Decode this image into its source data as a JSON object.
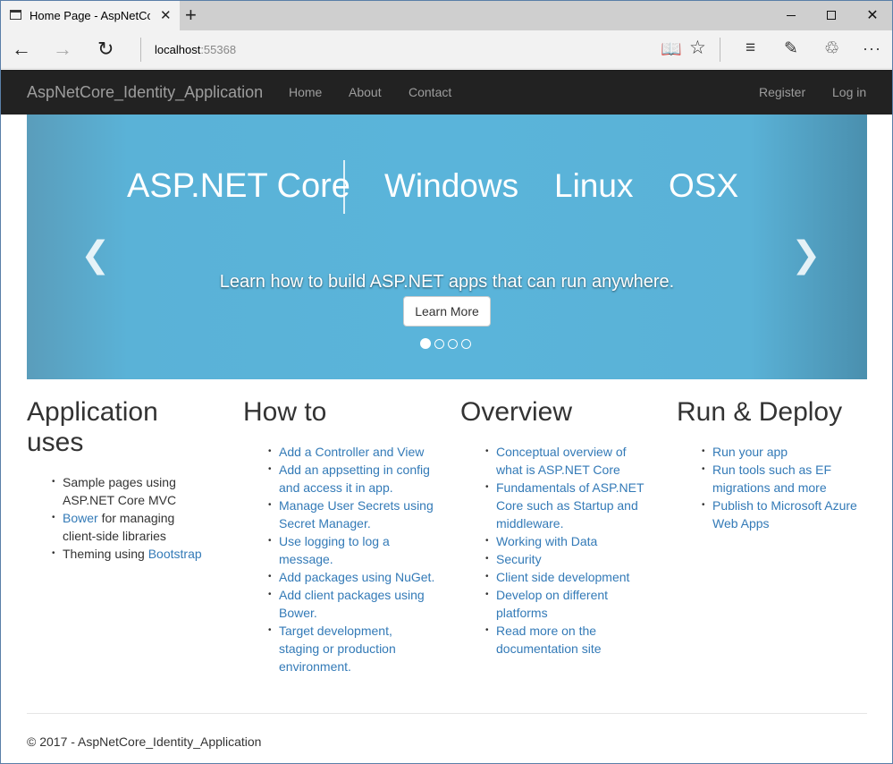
{
  "browser": {
    "tab_title": "Home Page - AspNetCo",
    "tab_close": "✕",
    "new_tab": "+",
    "url_host": "localhost",
    "url_port": ":55368"
  },
  "site": {
    "brand": "AspNetCore_Identity_Application",
    "nav": {
      "home": "Home",
      "about": "About",
      "contact": "Contact",
      "register": "Register",
      "login": "Log in"
    }
  },
  "carousel": {
    "words": {
      "aspnet": "ASP.NET Core",
      "windows": "Windows",
      "linux": "Linux",
      "osx": "OSX"
    },
    "caption": "Learn how to build ASP.NET apps that can run anywhere.",
    "button": "Learn More",
    "slide_count": 4,
    "active_slide": 1
  },
  "columns": [
    {
      "heading": "Application uses",
      "items": [
        {
          "text": "Sample pages using ASP.NET Core MVC"
        },
        {
          "link": "Bower",
          "rest": " for managing client-side libraries"
        },
        {
          "prefix": "Theming using ",
          "link": "Bootstrap"
        }
      ]
    },
    {
      "heading": "How to",
      "items": [
        "Add a Controller and View",
        "Add an appsetting in config and access it in app.",
        "Manage User Secrets using Secret Manager.",
        "Use logging to log a message.",
        "Add packages using NuGet.",
        "Add client packages using Bower.",
        "Target development, staging or production environment."
      ]
    },
    {
      "heading": "Overview",
      "items": [
        "Conceptual overview of what is ASP.NET Core",
        "Fundamentals of ASP.NET Core such as Startup and middleware.",
        "Working with Data",
        "Security",
        "Client side development",
        "Develop on different platforms",
        "Read more on the documentation site"
      ]
    },
    {
      "heading": "Run & Deploy",
      "items": [
        "Run your app",
        "Run tools such as EF migrations and more",
        "Publish to Microsoft Azure Web Apps"
      ]
    }
  ],
  "footer": {
    "text": "© 2017 - AspNetCore_Identity_Application"
  },
  "colors": {
    "navbar_bg": "#222222",
    "nav_text": "#9d9d9d",
    "link": "#337ab7",
    "carousel_blue": "#5ab4da"
  }
}
